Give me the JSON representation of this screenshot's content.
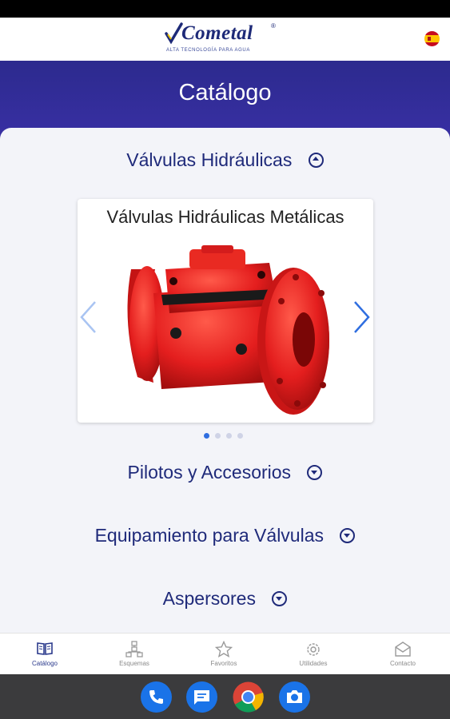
{
  "header": {
    "brand": "Cometal",
    "registered": "®",
    "tagline": "ALTA TECNOLOGÍA PARA AGUA",
    "language_icon": "spain-flag-icon"
  },
  "banner": {
    "title": "Catálogo"
  },
  "sections": [
    {
      "label": "Válvulas Hidráulicas",
      "state": "expanded"
    },
    {
      "label": "Pilotos y Accesorios",
      "state": "collapsed"
    },
    {
      "label": "Equipamiento para Válvulas",
      "state": "collapsed"
    },
    {
      "label": "Aspersores",
      "state": "collapsed"
    }
  ],
  "carousel": {
    "title": "Válvulas Hidráulicas Metálicas",
    "image": "red-hydraulic-valve",
    "page_count": 4,
    "active_page": 1
  },
  "bottom_nav": [
    {
      "label": "Catálogo",
      "icon": "book-icon",
      "active": true
    },
    {
      "label": "Esquemas",
      "icon": "diagram-icon",
      "active": false
    },
    {
      "label": "Favoritos",
      "icon": "star-icon",
      "active": false
    },
    {
      "label": "Utilidades",
      "icon": "gear-icon",
      "active": false
    },
    {
      "label": "Contacto",
      "icon": "mail-icon",
      "active": false
    }
  ],
  "dock": [
    "phone-icon",
    "messages-icon",
    "chrome-icon",
    "camera-icon"
  ],
  "colors": {
    "accent": "#1f2a7a",
    "banner": "#2c2a8e",
    "valve": "#e41e1e",
    "arrow": "#2f6ee0"
  }
}
